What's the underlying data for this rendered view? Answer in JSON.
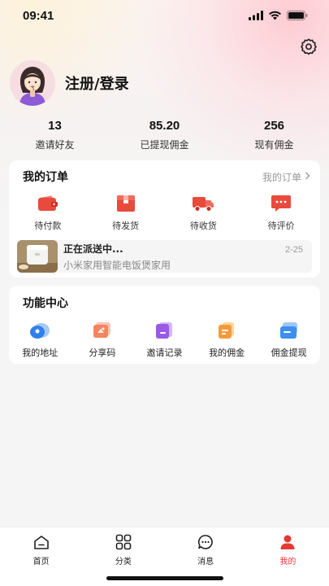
{
  "status_bar": {
    "time": "09:41"
  },
  "profile": {
    "login_label": "注册/登录"
  },
  "stats": [
    {
      "value": "13",
      "label": "邀请好友"
    },
    {
      "value": "85.20",
      "label": "已提现佣金"
    },
    {
      "value": "256",
      "label": "现有佣金"
    }
  ],
  "orders": {
    "title": "我的订单",
    "link": "我的订单",
    "items": [
      {
        "label": "待付款",
        "icon": "wallet-icon"
      },
      {
        "label": "待发货",
        "icon": "package-icon"
      },
      {
        "label": "待收货",
        "icon": "truck-icon"
      },
      {
        "label": "待评价",
        "icon": "comment-icon"
      }
    ],
    "delivery": {
      "status": "正在派送中...",
      "product": "小米家用智能电饭煲家用",
      "date": "2-25"
    }
  },
  "tools": {
    "title": "功能中心",
    "items": [
      {
        "label": "我的地址",
        "icon": "location-icon"
      },
      {
        "label": "分享码",
        "icon": "share-code-icon"
      },
      {
        "label": "邀请记录",
        "icon": "invite-record-icon"
      },
      {
        "label": "我的佣金",
        "icon": "commission-icon"
      },
      {
        "label": "佣金提现",
        "icon": "withdraw-icon"
      }
    ]
  },
  "tabbar": [
    {
      "label": "首页",
      "icon": "home-icon",
      "active": false
    },
    {
      "label": "分类",
      "icon": "category-icon",
      "active": false
    },
    {
      "label": "消息",
      "icon": "message-icon",
      "active": false
    },
    {
      "label": "我的",
      "icon": "profile-icon",
      "active": true
    }
  ],
  "colors": {
    "accent": "#e53935",
    "background": "#f5f5f5"
  }
}
